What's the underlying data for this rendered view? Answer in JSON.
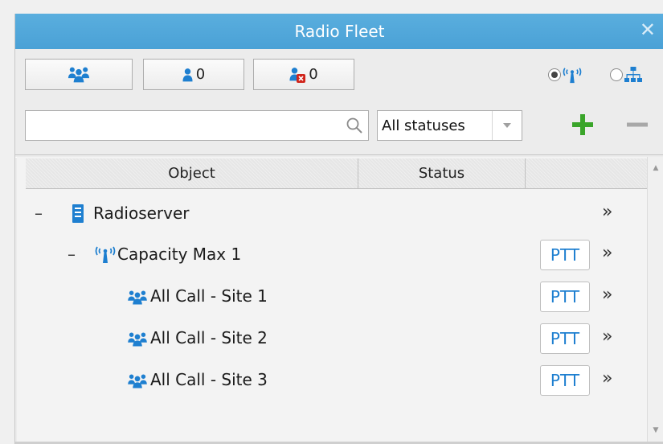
{
  "window": {
    "title": "Radio Fleet"
  },
  "toolbar": {
    "talkgroups_button": {
      "icon": "talkgroup-icon"
    },
    "radios_online_count": "0",
    "radios_offline_count": "0",
    "view_mode": {
      "selected": "radio-system",
      "options": [
        "radio-system-icon",
        "hierarchy-icon"
      ]
    }
  },
  "filter": {
    "search_value": "",
    "status_selected": "All statuses",
    "add_icon": "plus-icon",
    "remove_icon": "minus-icon"
  },
  "table": {
    "columns": [
      "Object",
      "Status",
      ""
    ],
    "rows": [
      {
        "toggle": "–",
        "icon": "server-icon",
        "label": "Radioserver",
        "ptt": "",
        "more": "»"
      },
      {
        "toggle": "–",
        "icon": "radio-system-icon",
        "label": "Capacity Max 1",
        "ptt": "PTT",
        "more": "»"
      },
      {
        "toggle": "",
        "icon": "talkgroup-icon",
        "label": "All Call - Site 1",
        "ptt": "PTT",
        "more": "»"
      },
      {
        "toggle": "",
        "icon": "talkgroup-icon",
        "label": "All Call - Site 2",
        "ptt": "PTT",
        "more": "»"
      },
      {
        "toggle": "",
        "icon": "talkgroup-icon",
        "label": "All Call - Site 3",
        "ptt": "PTT",
        "more": "»"
      }
    ]
  },
  "colors": {
    "title_bar": "#4aa1d6",
    "accent_blue": "#1e7fd0",
    "plus_green": "#3aa52a",
    "offline_red": "#d0241b"
  }
}
